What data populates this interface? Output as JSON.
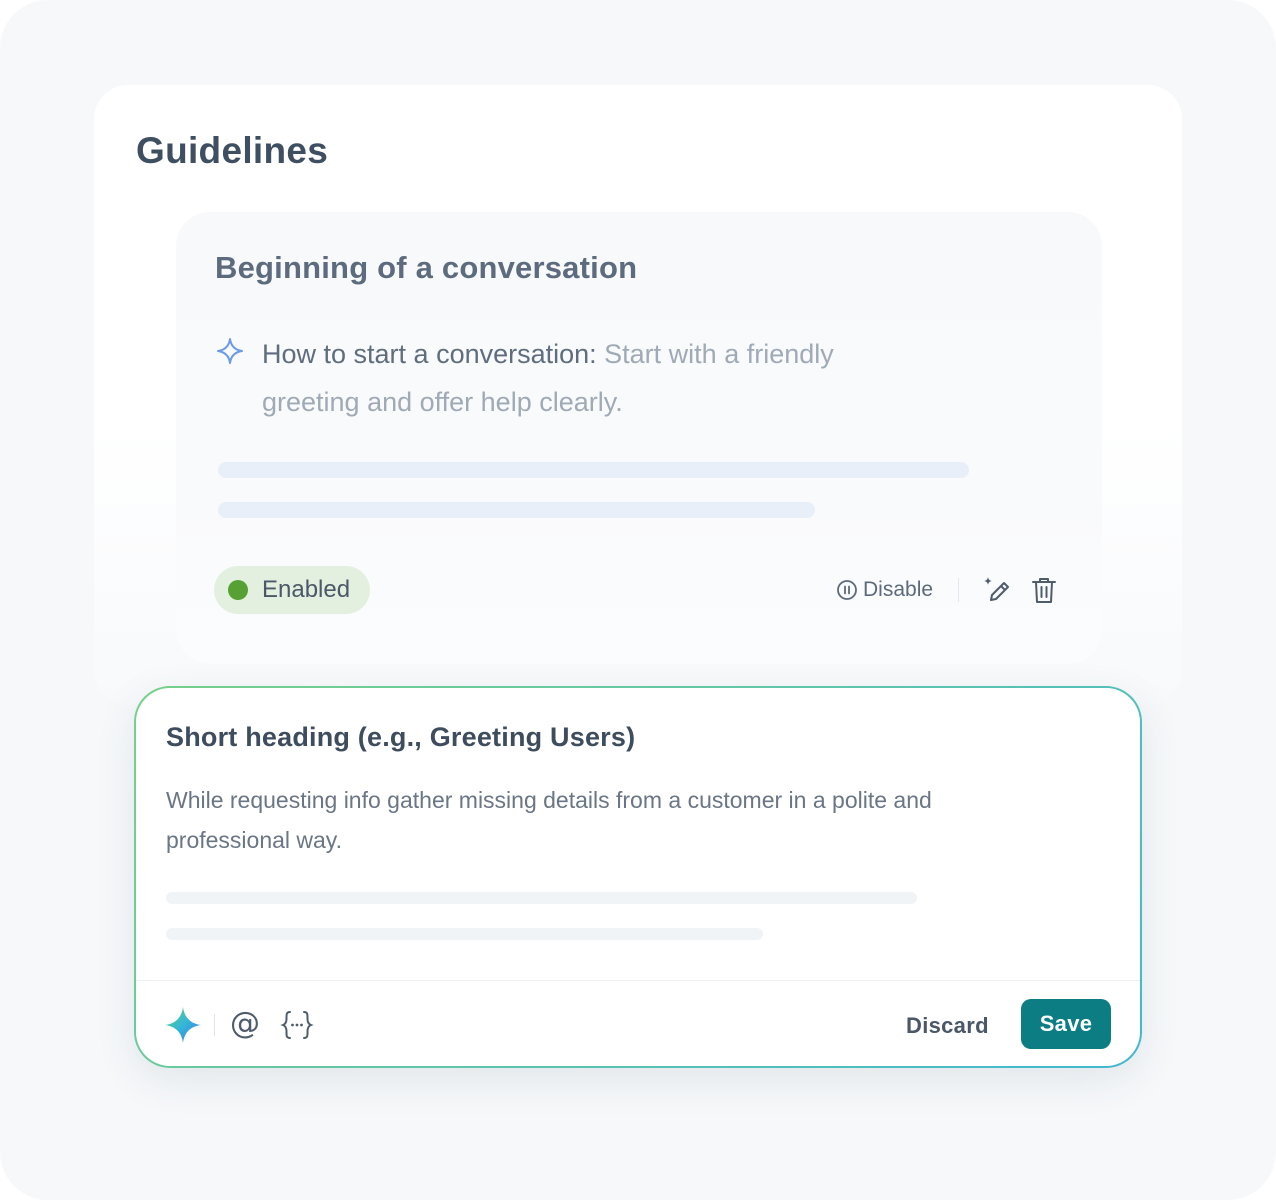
{
  "page": {
    "title": "Guidelines"
  },
  "guideline_card": {
    "title": "Beginning of a conversation",
    "item_lead": "How to start a conversation:",
    "item_text": " Start with a friendly greeting and offer help clearly.",
    "status_label": "Enabled",
    "disable_label": "Disable",
    "icons": [
      "sparkle-outline-icon",
      "pause-circle-icon",
      "ai-edit-icon",
      "trash-icon"
    ]
  },
  "editor": {
    "heading_placeholder": "Short heading (e.g., Greeting Users)",
    "body_placeholder": "While requesting info gather missing details from a customer in a polite and professional way.",
    "toolbar": {
      "mention_symbol": "@",
      "variable_symbol": "{···}",
      "icons": [
        "ai-sparkle-icon",
        "mention-icon",
        "variable-icon"
      ]
    },
    "discard_label": "Discard",
    "save_label": "Save"
  },
  "colors": {
    "accent_teal": "#0c7d83",
    "status_green": "#57a033",
    "status_bg": "#e4f0df",
    "border_gradient_start": "#76d08a",
    "border_gradient_end": "#41b8cf"
  }
}
